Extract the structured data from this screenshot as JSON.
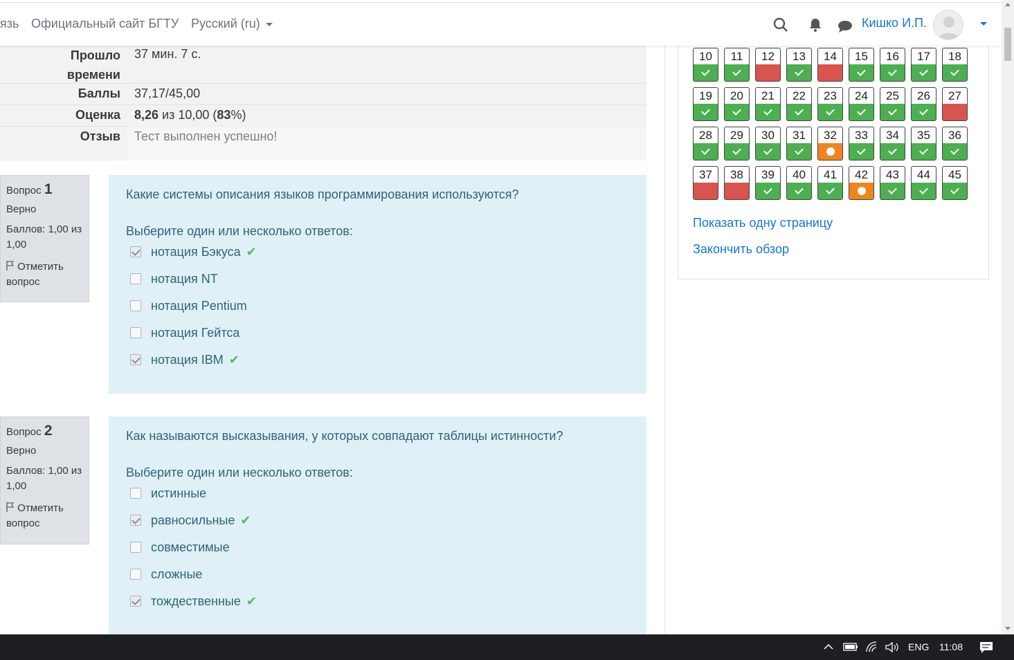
{
  "navbar": {
    "link_partial": "язь",
    "site_link": "Официальный сайт БГТУ",
    "language": "Русский ‎(ru)‎",
    "user_name": "Кишко И.П."
  },
  "summary": {
    "rows": [
      {
        "label_line1": "Прошло",
        "label_line2": "времени",
        "value": "37 мин. 7 с."
      },
      {
        "label": "Баллы",
        "value": "37,17/45,00"
      },
      {
        "label": "Оценка",
        "value_bold": "8,26",
        "value_mid": " из 10,00 (",
        "value_pct": "83",
        "value_end": "%)"
      },
      {
        "label": "Отзыв",
        "value": "Тест выполнен успешно!"
      }
    ]
  },
  "questions": [
    {
      "prefix": "Вопрос",
      "number": "1",
      "state": "Верно",
      "grade": "Баллов: 1,00 из 1,00",
      "flag": "Отметить вопрос",
      "text": "Какие системы описания языков программирования используются?",
      "prompt": "Выберите один или несколько ответов:",
      "answers": [
        {
          "text": "нотация Бэкуса",
          "checked": true,
          "correct": true
        },
        {
          "text": "нотация NT",
          "checked": false,
          "correct": false
        },
        {
          "text": "нотация Pentium",
          "checked": false,
          "correct": false
        },
        {
          "text": "нотация Гейтса",
          "checked": false,
          "correct": false
        },
        {
          "text": "нотация IBM",
          "checked": true,
          "correct": true
        }
      ]
    },
    {
      "prefix": "Вопрос",
      "number": "2",
      "state": "Верно",
      "grade": "Баллов: 1,00 из 1,00",
      "flag": "Отметить вопрос",
      "text": "Как называются высказывания, у которых совпадают таблицы истинности?",
      "prompt": "Выберите один или несколько ответов:",
      "answers": [
        {
          "text": "истинные",
          "checked": false,
          "correct": false
        },
        {
          "text": "равносильные",
          "checked": true,
          "correct": true
        },
        {
          "text": "совместимые",
          "checked": false,
          "correct": false
        },
        {
          "text": "сложные",
          "checked": false,
          "correct": false
        },
        {
          "text": "тождественные",
          "checked": true,
          "correct": true
        }
      ]
    }
  ],
  "quiz_nav": {
    "buttons": [
      {
        "n": "10",
        "s": "correct"
      },
      {
        "n": "11",
        "s": "correct"
      },
      {
        "n": "12",
        "s": "incorrect"
      },
      {
        "n": "13",
        "s": "correct"
      },
      {
        "n": "14",
        "s": "incorrect"
      },
      {
        "n": "15",
        "s": "correct"
      },
      {
        "n": "16",
        "s": "correct"
      },
      {
        "n": "17",
        "s": "correct"
      },
      {
        "n": "18",
        "s": "correct"
      },
      {
        "n": "19",
        "s": "correct"
      },
      {
        "n": "20",
        "s": "correct"
      },
      {
        "n": "21",
        "s": "correct"
      },
      {
        "n": "22",
        "s": "correct"
      },
      {
        "n": "23",
        "s": "correct"
      },
      {
        "n": "24",
        "s": "correct"
      },
      {
        "n": "25",
        "s": "correct"
      },
      {
        "n": "26",
        "s": "correct"
      },
      {
        "n": "27",
        "s": "incorrect"
      },
      {
        "n": "28",
        "s": "correct"
      },
      {
        "n": "29",
        "s": "correct"
      },
      {
        "n": "30",
        "s": "correct"
      },
      {
        "n": "31",
        "s": "correct"
      },
      {
        "n": "32",
        "s": "partial"
      },
      {
        "n": "33",
        "s": "correct"
      },
      {
        "n": "34",
        "s": "correct"
      },
      {
        "n": "35",
        "s": "correct"
      },
      {
        "n": "36",
        "s": "correct"
      },
      {
        "n": "37",
        "s": "incorrect"
      },
      {
        "n": "38",
        "s": "incorrect"
      },
      {
        "n": "39",
        "s": "correct"
      },
      {
        "n": "40",
        "s": "correct"
      },
      {
        "n": "41",
        "s": "correct"
      },
      {
        "n": "42",
        "s": "partial"
      },
      {
        "n": "43",
        "s": "correct"
      },
      {
        "n": "44",
        "s": "correct"
      },
      {
        "n": "45",
        "s": "correct"
      }
    ],
    "show_one_page": "Показать одну страницу",
    "finish_review": "Закончить обзор"
  },
  "taskbar": {
    "lang": "ENG",
    "time": "11:08"
  },
  "colors": {
    "correct": "#4caf50",
    "incorrect": "#d9534f",
    "partial": "#f0841e",
    "link": "#1177d1",
    "question_bg": "#dff0f7"
  }
}
